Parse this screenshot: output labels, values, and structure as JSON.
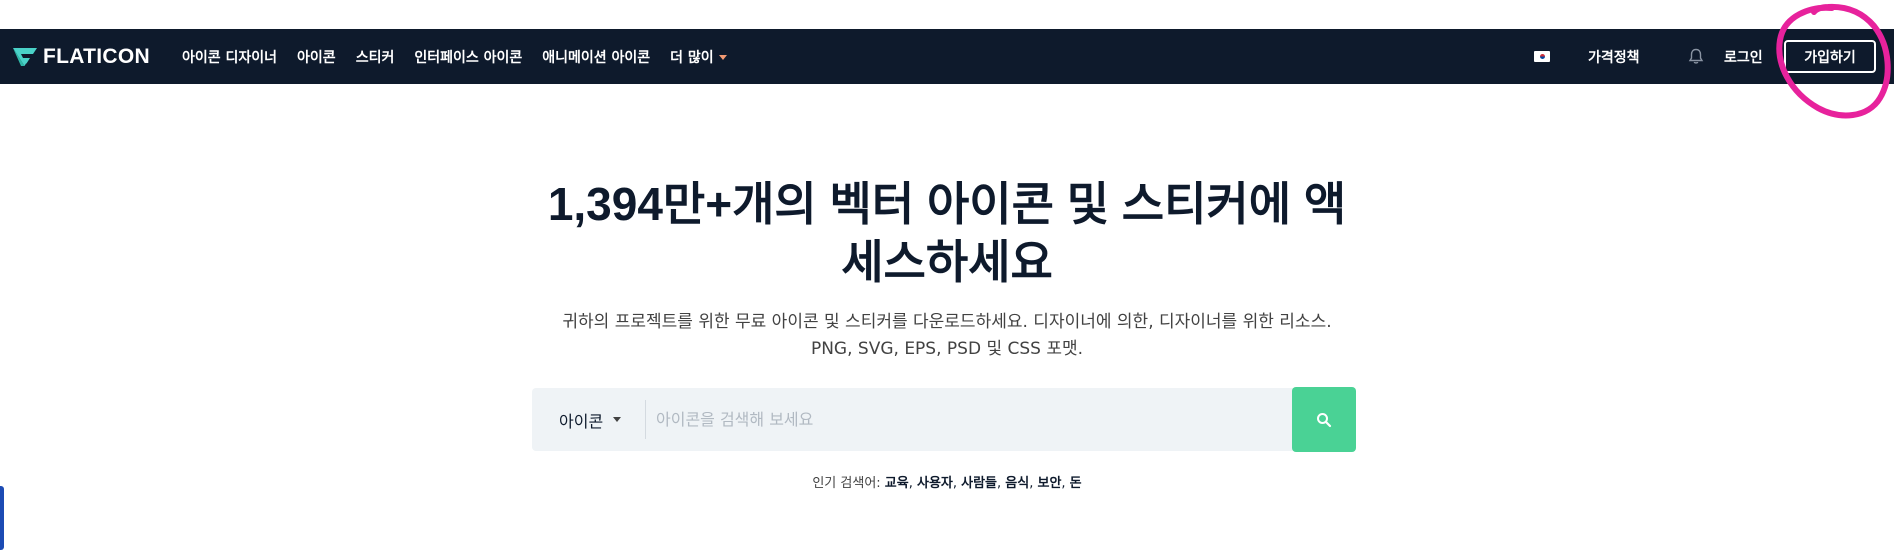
{
  "header": {
    "logo_text": "FLATICON",
    "nav": [
      {
        "label": "아이콘 디자이너"
      },
      {
        "label": "아이콘"
      },
      {
        "label": "스티커"
      },
      {
        "label": "인터페이스 아이콘"
      },
      {
        "label": "애니메이션 아이콘"
      },
      {
        "label": "더 많이"
      }
    ],
    "pricing": "가격정책",
    "login": "로그인",
    "signup": "가입하기"
  },
  "hero": {
    "title": "1,394만+개의 벡터 아이콘 및 스티커에 액세스하세요",
    "subtitle": "귀하의 프로젝트를 위한 무료 아이콘 및 스티커를 다운로드하세요. 디자이너에 의한, 디자이너를 위한 리소스. PNG, SVG, EPS, PSD 및 CSS 포맷."
  },
  "search": {
    "type_selected": "아이콘",
    "placeholder": "아이콘을 검색해 보세요"
  },
  "popular": {
    "label": "인기 검색어:",
    "terms": [
      "교육",
      "사용자",
      "사람들",
      "음식",
      "보안",
      "돈"
    ]
  },
  "colors": {
    "navbar": "#0e1a2c",
    "search_button": "#4ad295",
    "accent_caret": "#f29a74",
    "annotation": "#e7229c",
    "logo_teal": "#4ad2c8"
  }
}
